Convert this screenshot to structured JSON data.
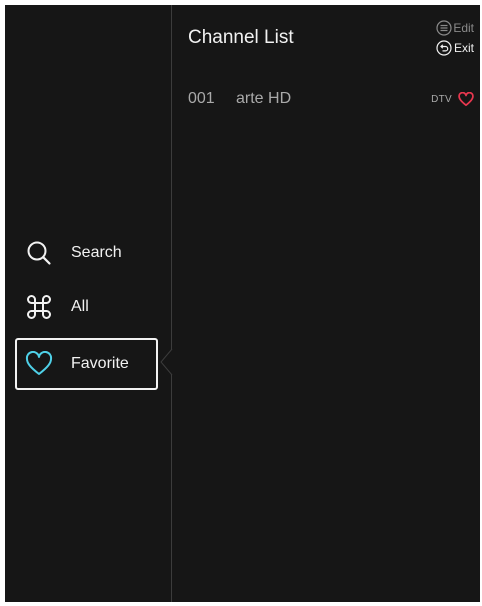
{
  "sidebar": {
    "items": [
      {
        "label": "Search",
        "icon": "search-icon"
      },
      {
        "label": "All",
        "icon": "command-icon"
      },
      {
        "label": "Favorite",
        "icon": "heart-icon",
        "selected": true
      }
    ]
  },
  "main": {
    "title": "Channel List",
    "hints": {
      "edit_label": "Edit",
      "exit_label": "Exit"
    },
    "channels": [
      {
        "number": "001",
        "name": "arte HD",
        "type": "DTV",
        "favorite": true
      }
    ]
  },
  "colors": {
    "background": "#161616",
    "text": "#f2f2f2",
    "muted_text": "#a9a9a9",
    "favorite_icon_accent": "#4fd1e8",
    "favorite_heart": "#e8374f"
  }
}
